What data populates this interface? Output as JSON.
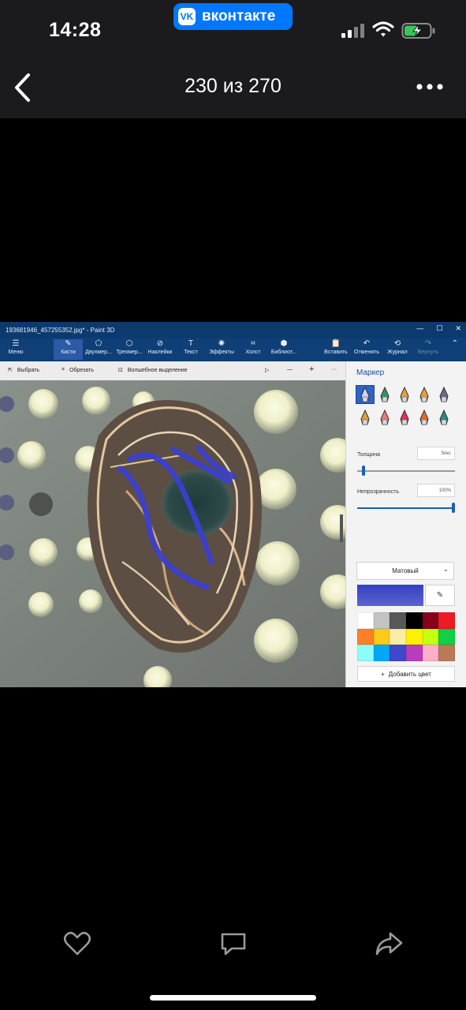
{
  "status_bar": {
    "time": "14:28",
    "vk_pill_label": "вконтакте",
    "vk_logo_text": "VK",
    "icons": [
      "signal-icon",
      "wifi-icon",
      "battery-charging-icon"
    ]
  },
  "viewer": {
    "counter": "230 из 270",
    "icons": [
      "back-chevron-icon",
      "more-dots-icon"
    ]
  },
  "photo": {
    "window_title": "193681946_457255352.jpg* - Paint 3D",
    "window_controls": [
      "—",
      "☐",
      "✕"
    ],
    "ribbon": [
      {
        "label": "Меню",
        "icon": "☰"
      },
      {
        "label": "Кисти",
        "icon": "✎"
      },
      {
        "label": "Двухмер...",
        "icon": "⬠"
      },
      {
        "label": "Трехмер...",
        "icon": "⬡"
      },
      {
        "label": "Наклейки",
        "icon": "⊘"
      },
      {
        "label": "Текст",
        "icon": "T"
      },
      {
        "label": "Эффекты",
        "icon": "✺"
      },
      {
        "label": "Холст",
        "icon": "⌗"
      },
      {
        "label": "Библиот...",
        "icon": "⬢"
      }
    ],
    "ribbon_right": [
      {
        "label": "Вставить",
        "icon": "📋"
      },
      {
        "label": "Отменить",
        "icon": "↶"
      },
      {
        "label": "Журнал",
        "icon": "⟲"
      },
      {
        "label": "Вернуть",
        "icon": "↷"
      }
    ],
    "tools": {
      "select": "Выбрать",
      "crop": "Обрезать",
      "magic_select": "Волшебное выделение",
      "zoom_minus": "—",
      "zoom_plus": "+",
      "more": "···"
    },
    "panel": {
      "title": "Маркер",
      "thickness_label": "Толщина",
      "thickness_value": "5пкс",
      "thickness": 0.05,
      "opacity_label": "Непрозрачность",
      "opacity_value": "100%",
      "opacity": 1.0,
      "finish": "Матовый",
      "add_color": "Добавить цвет",
      "current_color": "#3340bf",
      "palette": [
        "#ffffff",
        "#c3c3c3",
        "#585858",
        "#000000",
        "#88001b",
        "#ec1c24",
        "#ff7f27",
        "#ffca18",
        "#fdeca6",
        "#fff200",
        "#c4ff0e",
        "#0ed145",
        "#8cfffb",
        "#00a8f3",
        "#3f48cc",
        "#b83dba",
        "#ffaec8",
        "#b97a56"
      ],
      "brushes": [
        {
          "name": "marker",
          "color": "#cfd6ff"
        },
        {
          "name": "calligraphy-pen",
          "color": "#2e9a5f"
        },
        {
          "name": "oil-brush",
          "color": "#e7a33b"
        },
        {
          "name": "watercolor",
          "color": "#f0a030"
        },
        {
          "name": "pixel-pen",
          "color": "#6b6b8c"
        },
        {
          "name": "pencil",
          "color": "#e0a040"
        },
        {
          "name": "eraser",
          "color": "#f07a7a"
        },
        {
          "name": "crayon",
          "color": "#e0315a"
        },
        {
          "name": "spray-can",
          "color": "#e86a20"
        },
        {
          "name": "fill",
          "color": "#2a8a8c"
        }
      ]
    }
  },
  "actions": {
    "icons": [
      "like-heart-icon",
      "comment-icon",
      "share-icon"
    ]
  }
}
